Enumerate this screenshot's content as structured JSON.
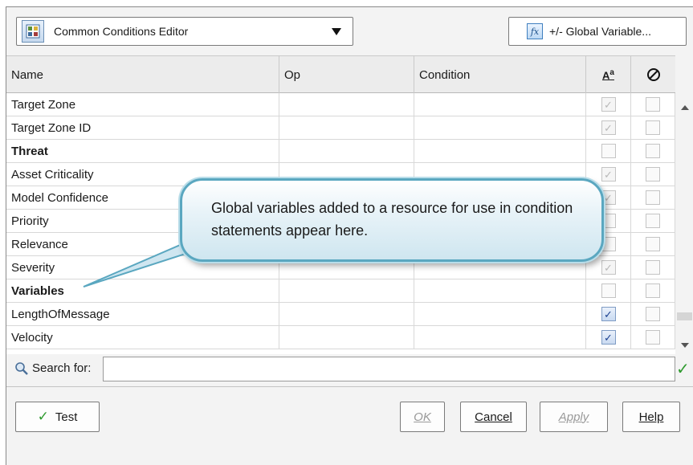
{
  "toolbar": {
    "editor_name": "Common Conditions Editor",
    "global_variable_button": "+/- Global Variable..."
  },
  "table": {
    "columns": [
      "Name",
      "Op",
      "Condition",
      "Aa",
      "⊘"
    ],
    "rows": [
      {
        "name": "Target Zone",
        "op": "",
        "condition": "",
        "bold": false,
        "case": "disabled-checked",
        "negate": "unchecked"
      },
      {
        "name": "Target Zone ID",
        "op": "",
        "condition": "",
        "bold": false,
        "case": "disabled-checked",
        "negate": "unchecked"
      },
      {
        "name": "Threat",
        "op": "",
        "condition": "",
        "bold": true,
        "case": "unchecked",
        "negate": "unchecked"
      },
      {
        "name": "Asset Criticality",
        "op": "",
        "condition": "",
        "bold": false,
        "case": "disabled-checked",
        "negate": "unchecked"
      },
      {
        "name": "Model Confidence",
        "op": "",
        "condition": "",
        "bold": false,
        "case": "disabled-checked",
        "negate": "unchecked"
      },
      {
        "name": "Priority",
        "op": "",
        "condition": "",
        "bold": false,
        "case": "unchecked",
        "negate": "unchecked"
      },
      {
        "name": "Relevance",
        "op": "",
        "condition": "",
        "bold": false,
        "case": "unchecked",
        "negate": "unchecked"
      },
      {
        "name": "Severity",
        "op": "",
        "condition": "",
        "bold": false,
        "case": "disabled-checked",
        "negate": "unchecked"
      },
      {
        "name": "Variables",
        "op": "",
        "condition": "",
        "bold": true,
        "case": "unchecked",
        "negate": "unchecked"
      },
      {
        "name": "LengthOfMessage",
        "op": "",
        "condition": "",
        "bold": false,
        "case": "checked",
        "negate": "unchecked"
      },
      {
        "name": "Velocity",
        "op": "",
        "condition": "",
        "bold": false,
        "case": "checked",
        "negate": "unchecked"
      }
    ]
  },
  "search": {
    "label": "Search for:",
    "value": ""
  },
  "buttons": {
    "test": "Test",
    "ok": "OK",
    "cancel": "Cancel",
    "apply": "Apply",
    "help": "Help"
  },
  "callout": {
    "text": "Global variables added to a resource for use in condition statements appear here."
  },
  "colors": {
    "callout_border": "#5aa7c0",
    "check_green": "#2e9a2e",
    "checkbox_blue": "#1a3f8f"
  }
}
